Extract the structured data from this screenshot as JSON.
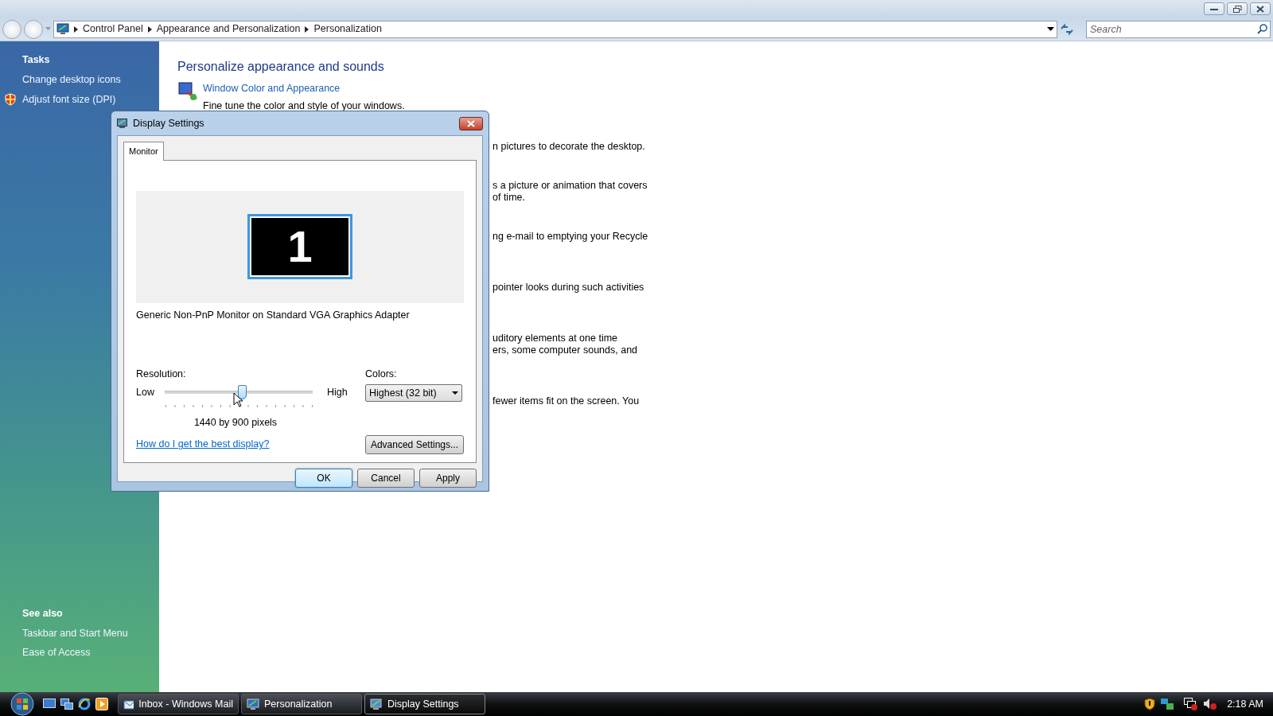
{
  "window": {
    "breadcrumbs": [
      "Control Panel",
      "Appearance and Personalization",
      "Personalization"
    ],
    "search": {
      "placeholder": "Search"
    }
  },
  "sidebar": {
    "tasks_title": "Tasks",
    "tasks": [
      {
        "label": "Change desktop icons",
        "kind": "plain"
      },
      {
        "label": "Adjust font size (DPI)",
        "kind": "shield"
      }
    ],
    "see_also_title": "See also",
    "see_also": [
      "Taskbar and Start Menu",
      "Ease of Access"
    ]
  },
  "content": {
    "title": "Personalize appearance and sounds",
    "items": [
      {
        "link": "Window Color and Appearance",
        "description": "Fine tune the color and style of your windows."
      }
    ],
    "fragments": [
      {
        "lines": [
          "n pictures to decorate the desktop."
        ]
      },
      {
        "lines": [
          "s a picture or animation that covers",
          "of time."
        ]
      },
      {
        "lines": [
          "ng e-mail to emptying your Recycle"
        ]
      },
      {
        "lines": [
          "pointer looks during such activities"
        ]
      },
      {
        "lines": [
          "uditory elements at one time",
          "ers, some computer sounds, and"
        ]
      },
      {
        "lines": [
          "fewer items fit on the screen. You"
        ]
      }
    ]
  },
  "dialog": {
    "title": "Display Settings",
    "tabs": [
      {
        "label": "Monitor",
        "selected": true
      }
    ],
    "monitor": {
      "number": "1",
      "selected": true,
      "name": "Generic Non-PnP Monitor on Standard VGA Graphics Adapter"
    },
    "resolution": {
      "label": "Resolution:",
      "low": "Low",
      "high": "High",
      "level": 0.52,
      "reading": "1440 by 900 pixels"
    },
    "colors": {
      "label": "Colors:",
      "value": "Highest (32 bit)"
    },
    "help_link": "How do I get the best display?",
    "advanced_button": "Advanced Settings...",
    "buttons": [
      {
        "label": "OK",
        "default": true
      },
      {
        "label": "Cancel",
        "default": false
      },
      {
        "label": "Apply",
        "default": false
      }
    ]
  },
  "taskbar": {
    "tasks": [
      {
        "label": "Inbox - Windows Mail",
        "selected": false
      },
      {
        "label": "Personalization",
        "selected": false
      },
      {
        "label": "Display Settings",
        "selected": true
      }
    ],
    "clock": "2:18 AM"
  }
}
